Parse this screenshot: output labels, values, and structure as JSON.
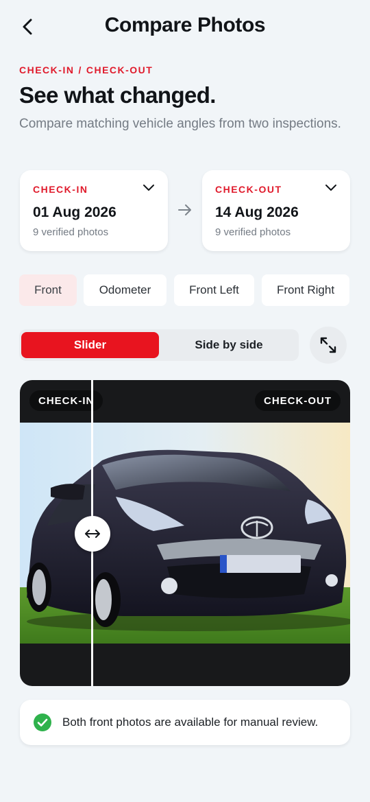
{
  "header": {
    "title": "Compare Photos",
    "back_icon": "chevron-left-icon"
  },
  "intro": {
    "eyebrow_left": "CHECK-IN",
    "eyebrow_sep": "/",
    "eyebrow_right": "CHECK-OUT",
    "headline": "See what changed.",
    "subtitle": "Compare matching vehicle angles from two inspections."
  },
  "inspections": [
    {
      "label": "CHECK-IN",
      "date": "01 Aug 2026",
      "count": "9 verified photos"
    },
    {
      "label": "CHECK-OUT",
      "date": "14 Aug 2026",
      "count": "9 verified photos"
    }
  ],
  "angles": [
    {
      "label": "Front",
      "active": true
    },
    {
      "label": "Odometer",
      "active": false
    },
    {
      "label": "Front Left",
      "active": false
    },
    {
      "label": "Front Right",
      "active": false
    }
  ],
  "view_mode": {
    "options": [
      "Slider",
      "Side by side"
    ],
    "selected": "Slider"
  },
  "viewer": {
    "left_label": "CHECK-IN",
    "right_label": "CHECK-OUT",
    "slider_position": 0.22
  },
  "status": {
    "message": "Both front photos are available for manual review.",
    "color": "#2fb24c"
  },
  "colors": {
    "accent": "#e8141f",
    "label_red": "#e01a2b",
    "background": "#f1f5f8"
  }
}
